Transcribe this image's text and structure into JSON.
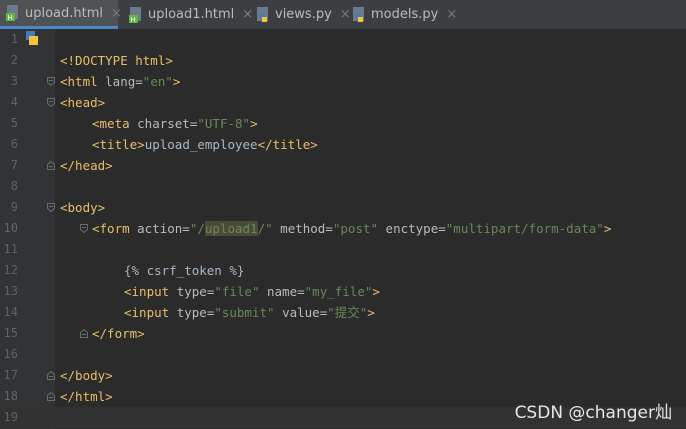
{
  "tabs": [
    {
      "label": "upload.html",
      "type": "html",
      "active": true
    },
    {
      "label": "upload1.html",
      "type": "html",
      "active": false
    },
    {
      "label": "views.py",
      "type": "py",
      "active": false
    },
    {
      "label": "models.py",
      "type": "py",
      "active": false
    }
  ],
  "close_glyph": "×",
  "line_numbers": [
    "1",
    "2",
    "3",
    "4",
    "5",
    "6",
    "7",
    "8",
    "9",
    "10",
    "11",
    "12",
    "13",
    "14",
    "15",
    "16",
    "17",
    "18",
    "19"
  ],
  "code": {
    "l2_doctype": "<!DOCTYPE html>",
    "l3_open": "<html ",
    "l3_attr": "lang=",
    "l3_val": "\"en\"",
    "l3_close": ">",
    "l4": "<head>",
    "l5_open": "<meta ",
    "l5_attr": "charset=",
    "l5_val": "\"UTF-8\"",
    "l5_close": ">",
    "l6_open": "<title>",
    "l6_text": "upload_employee",
    "l6_close": "</title>",
    "l7": "</head>",
    "l9": "<body>",
    "l10_open": "<form ",
    "l10_attr1": "action=",
    "l10_val1a": "\"/",
    "l10_val1b": "upload1",
    "l10_val1c": "/\"",
    "l10_attr2": " method=",
    "l10_val2": "\"post\"",
    "l10_attr3": " enctype=",
    "l10_val3": "\"multipart/form-data\"",
    "l10_close": ">",
    "l12": "{% csrf_token %}",
    "l13_open": "<input ",
    "l13_attr1": "type=",
    "l13_val1": "\"file\"",
    "l13_attr2": " name=",
    "l13_val2": "\"my_file\"",
    "l13_close": ">",
    "l14_open": "<input ",
    "l14_attr1": "type=",
    "l14_val1": "\"submit\"",
    "l14_attr2": " value=",
    "l14_val2": "\"提交\"",
    "l14_close": ">",
    "l15": "</form>",
    "l17": "</body>",
    "l18": "</html>"
  },
  "watermark": "CSDN @changer灿",
  "colors": {
    "tag": "#e8bf6a",
    "string": "#6a8759",
    "attr": "#bababa",
    "background": "#2b2b2b"
  }
}
